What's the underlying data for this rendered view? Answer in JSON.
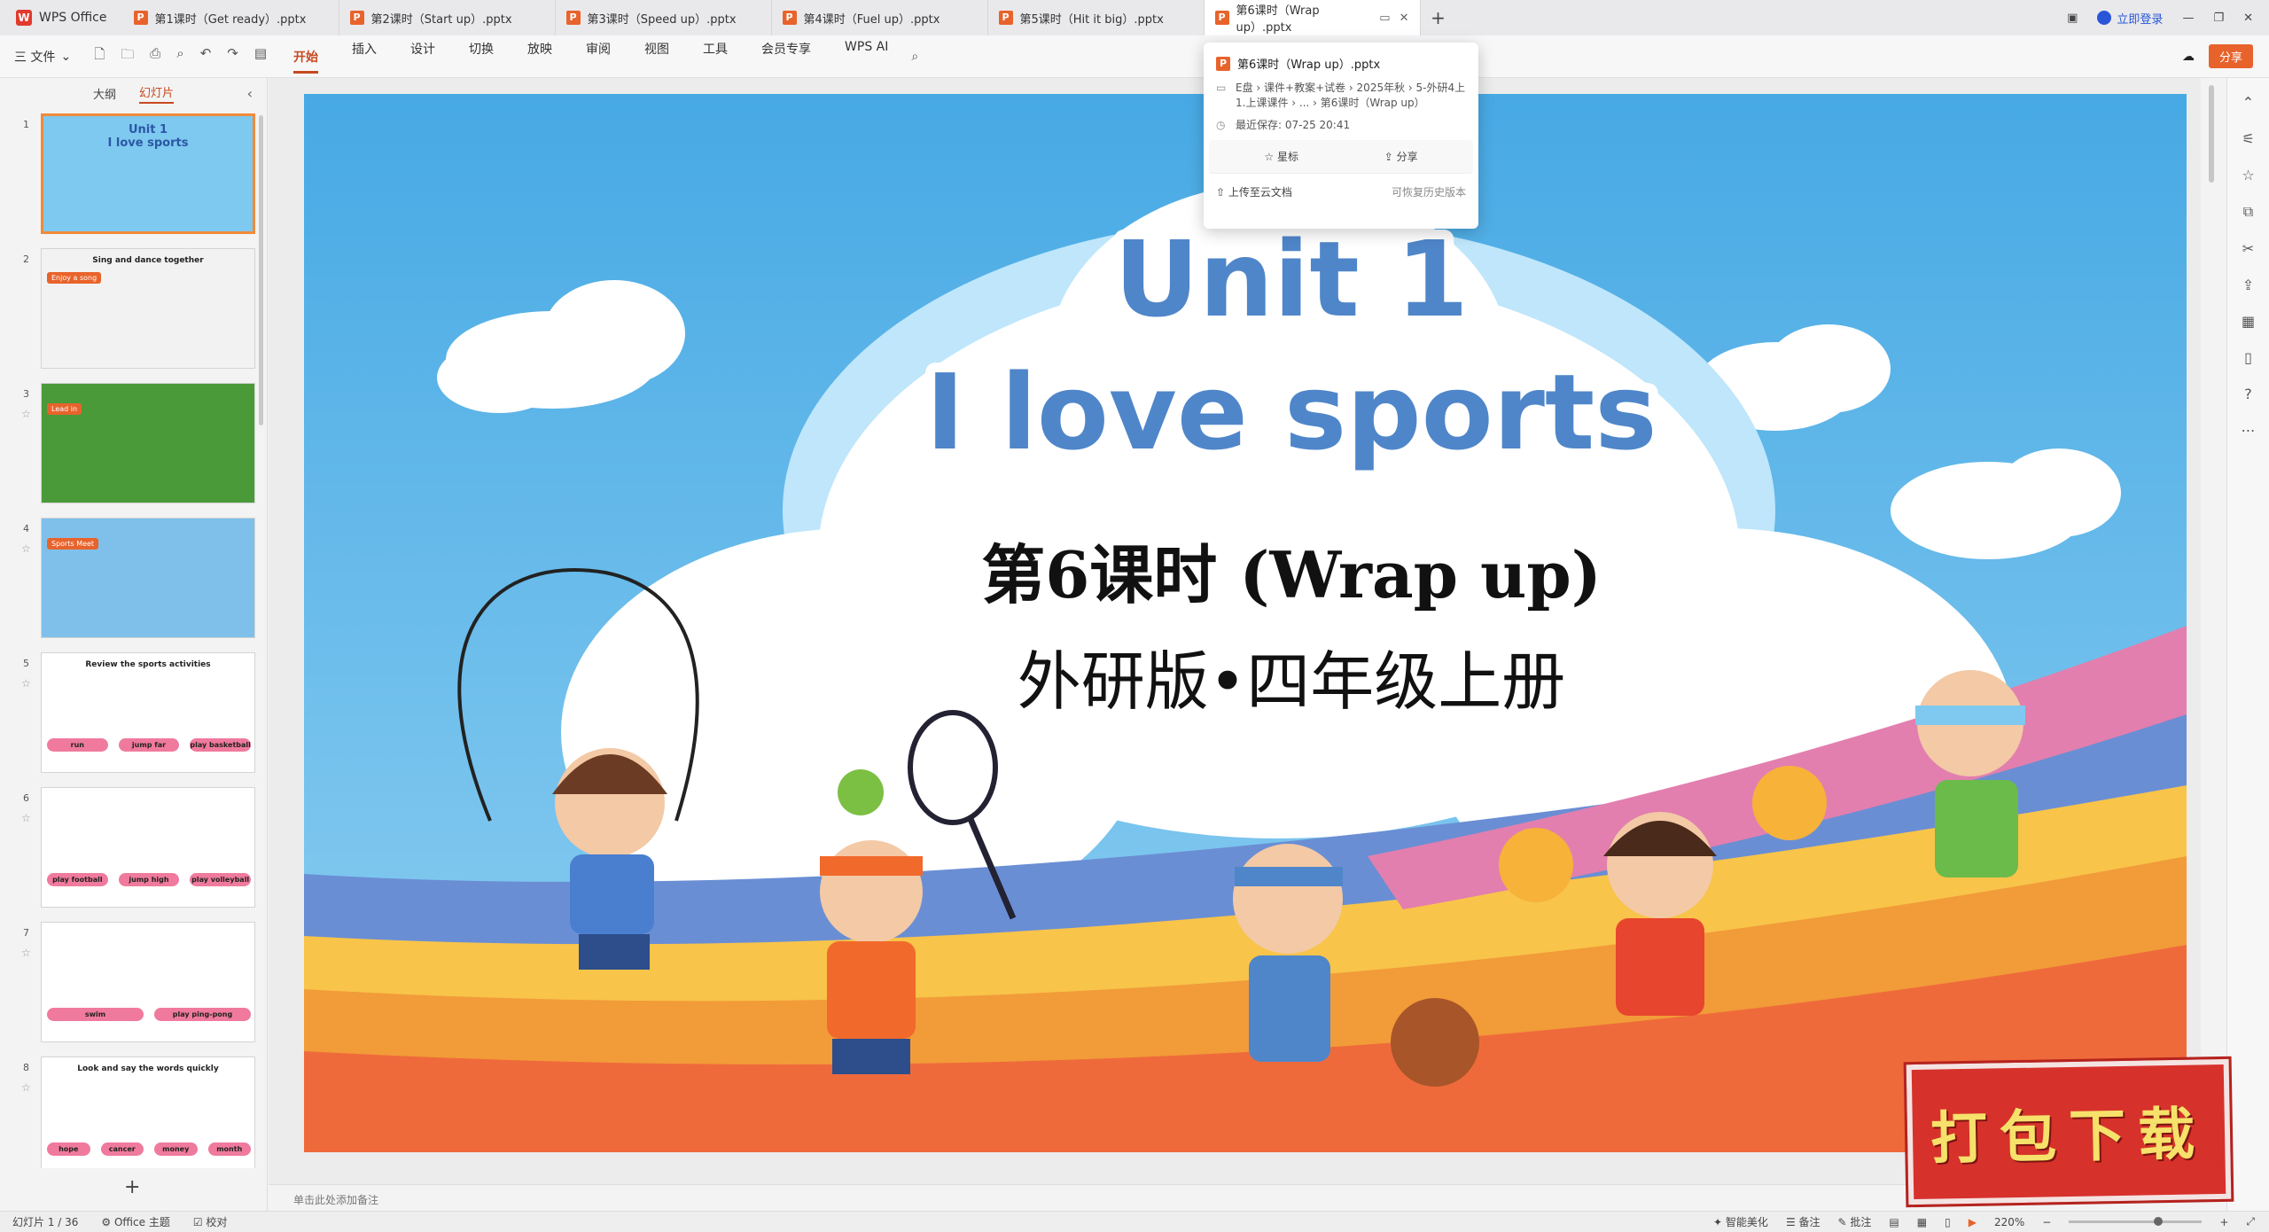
{
  "app": {
    "name": "WPS Office"
  },
  "tabs": [
    {
      "label": "第1课时（Get ready）.pptx"
    },
    {
      "label": "第2课时（Start up）.pptx"
    },
    {
      "label": "第3课时（Speed up）.pptx"
    },
    {
      "label": "第4课时（Fuel up）.pptx"
    },
    {
      "label": "第5课时（Hit it big）.pptx"
    },
    {
      "label": "第6课时（Wrap up）.pptx"
    }
  ],
  "window": {
    "login": "立即登录"
  },
  "toolbar": {
    "file": "三 文件",
    "menu": [
      "开始",
      "插入",
      "设计",
      "切换",
      "放映",
      "审阅",
      "视图",
      "工具",
      "会员专享",
      "WPS AI"
    ],
    "share": "分享"
  },
  "panel": {
    "tab_outline": "大纲",
    "tab_slides": "幻灯片",
    "thumbs": [
      {
        "num": "1",
        "text": "Unit 1\nI love sports"
      },
      {
        "num": "2",
        "text": "Sing and dance together",
        "badge": "Enjoy a song"
      },
      {
        "num": "3",
        "badge": "Lead in"
      },
      {
        "num": "4",
        "badge": "Sports Meet"
      },
      {
        "num": "5",
        "text": "Review the sports activities",
        "labels": [
          "run",
          "jump far",
          "play basketball"
        ]
      },
      {
        "num": "6",
        "labels": [
          "play football",
          "jump high",
          "play volleyball"
        ]
      },
      {
        "num": "7",
        "labels": [
          "swim",
          "play ping-pong"
        ]
      },
      {
        "num": "8",
        "text": "Look and say the words quickly",
        "labels": [
          "hope",
          "cancer",
          "money",
          "month"
        ]
      }
    ]
  },
  "slide": {
    "title1": "Unit 1",
    "title2": "I love sports",
    "subtitle": "第6课时 (Wrap up)",
    "edition": "外研版•四年级上册"
  },
  "notes": {
    "placeholder": "单击此处添加备注"
  },
  "popup": {
    "title": "第6课时（Wrap up）.pptx",
    "path": "E盘 › 课件+教案+试卷 › 2025年秋 › 5-外研4上1.上课课件 › ... › 第6课时（Wrap up）",
    "saved": "最近保存: 07-25 20:41",
    "star": "星标",
    "share": "分享",
    "upload": "上传至云文档",
    "history": "可恢复历史版本"
  },
  "status": {
    "slide_count": "幻灯片 1 / 36",
    "theme": "Office 主题",
    "proof": "校对",
    "beautify": "智能美化",
    "notes_btn": "备注",
    "comment": "批注",
    "zoom": "220%"
  },
  "stamp": {
    "text": "打包下载"
  },
  "colors": {
    "accent": "#c8491f",
    "ppt_icon": "#e8632b",
    "sky": "#55b6ea",
    "title_blue": "#4f86c9",
    "stamp_red": "#d7312b"
  }
}
